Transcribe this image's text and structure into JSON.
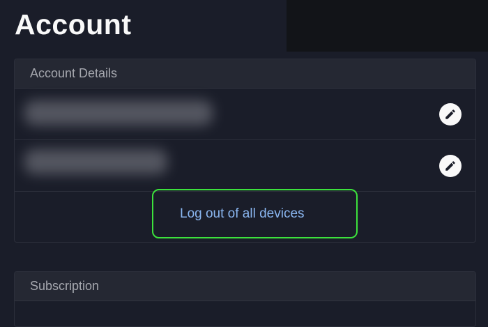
{
  "page": {
    "title": "Account"
  },
  "account_details": {
    "header": "Account Details",
    "rows": [
      {
        "value": "",
        "edit_icon": "pencil-icon"
      },
      {
        "value": "",
        "edit_icon": "pencil-icon"
      }
    ],
    "logout_label": "Log out of all devices"
  },
  "subscription": {
    "header": "Subscription"
  },
  "colors": {
    "background": "#1a1d29",
    "card_header": "#252833",
    "link": "#8ab6f0",
    "highlight": "#3ce23c"
  }
}
